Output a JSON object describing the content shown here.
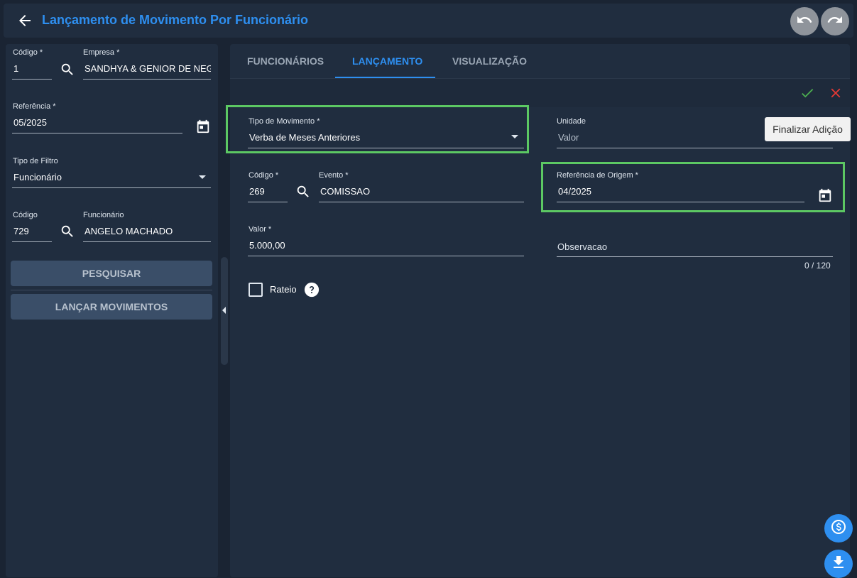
{
  "header": {
    "title": "Lançamento de Movimento Por Funcionário"
  },
  "filters": {
    "codigo_label": "Código *",
    "codigo_value": "1",
    "empresa_label": "Empresa *",
    "empresa_value": "SANDHYA & GENIOR DE NEGO",
    "referencia_label": "Referência *",
    "referencia_value": "05/2025",
    "tipo_filtro_label": "Tipo de Filtro",
    "tipo_filtro_value": "Funcionário",
    "func_codigo_label": "Código",
    "func_codigo_value": "729",
    "funcionario_label": "Funcionário",
    "funcionario_value": "ANGELO MACHADO",
    "pesquisar_label": "PESQUISAR",
    "lancar_label": "LANÇAR MOVIMENTOS"
  },
  "tabs": [
    {
      "label": "FUNCIONÁRIOS"
    },
    {
      "label": "LANÇAMENTO"
    },
    {
      "label": "VISUALIZAÇÃO"
    }
  ],
  "form": {
    "tipo_movimento_label": "Tipo de Movimento *",
    "tipo_movimento_value": "Verba de Meses Anteriores",
    "unidade_label": "Unidade",
    "unidade_value": "Valor",
    "codigo_label": "Código *",
    "codigo_value": "269",
    "evento_label": "Evento *",
    "evento_value": "COMISSAO",
    "ref_origem_label": "Referência de Origem *",
    "ref_origem_value": "04/2025",
    "valor_label": "Valor *",
    "valor_value": "5.000,00",
    "observacao_placeholder": "Observacao",
    "observacao_counter": "0 / 120",
    "rateio_label": "Rateio"
  },
  "tooltip": "Finalizar Adição",
  "colors": {
    "accent": "#2e8ff0",
    "highlight": "#5cc863",
    "confirm": "#4caf50",
    "cancel": "#e53935"
  }
}
